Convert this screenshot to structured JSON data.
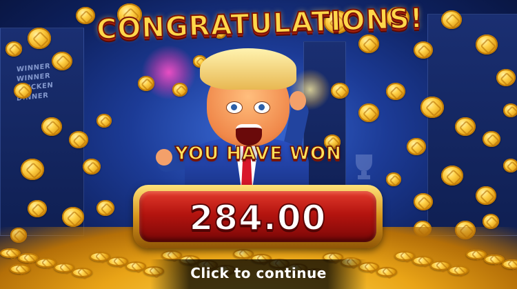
{
  "banner": {
    "title": "CONGRATULATIONS!",
    "won_label": "YOU HAVE WON"
  },
  "win": {
    "amount": "284.00"
  },
  "background": {
    "sign_lines": [
      "WINNER",
      "WINNER",
      "CHICKEN",
      "DINNER"
    ]
  },
  "prompt": {
    "continue_label": "Click to continue"
  },
  "colors": {
    "title_gold": "#ffd74a",
    "panel_red": "#b4140f",
    "panel_border_gold": "#d6951c",
    "background_blue": "#1c3b96"
  },
  "icons": [
    "coin-icon",
    "trophy-icon",
    "firework-icon"
  ]
}
